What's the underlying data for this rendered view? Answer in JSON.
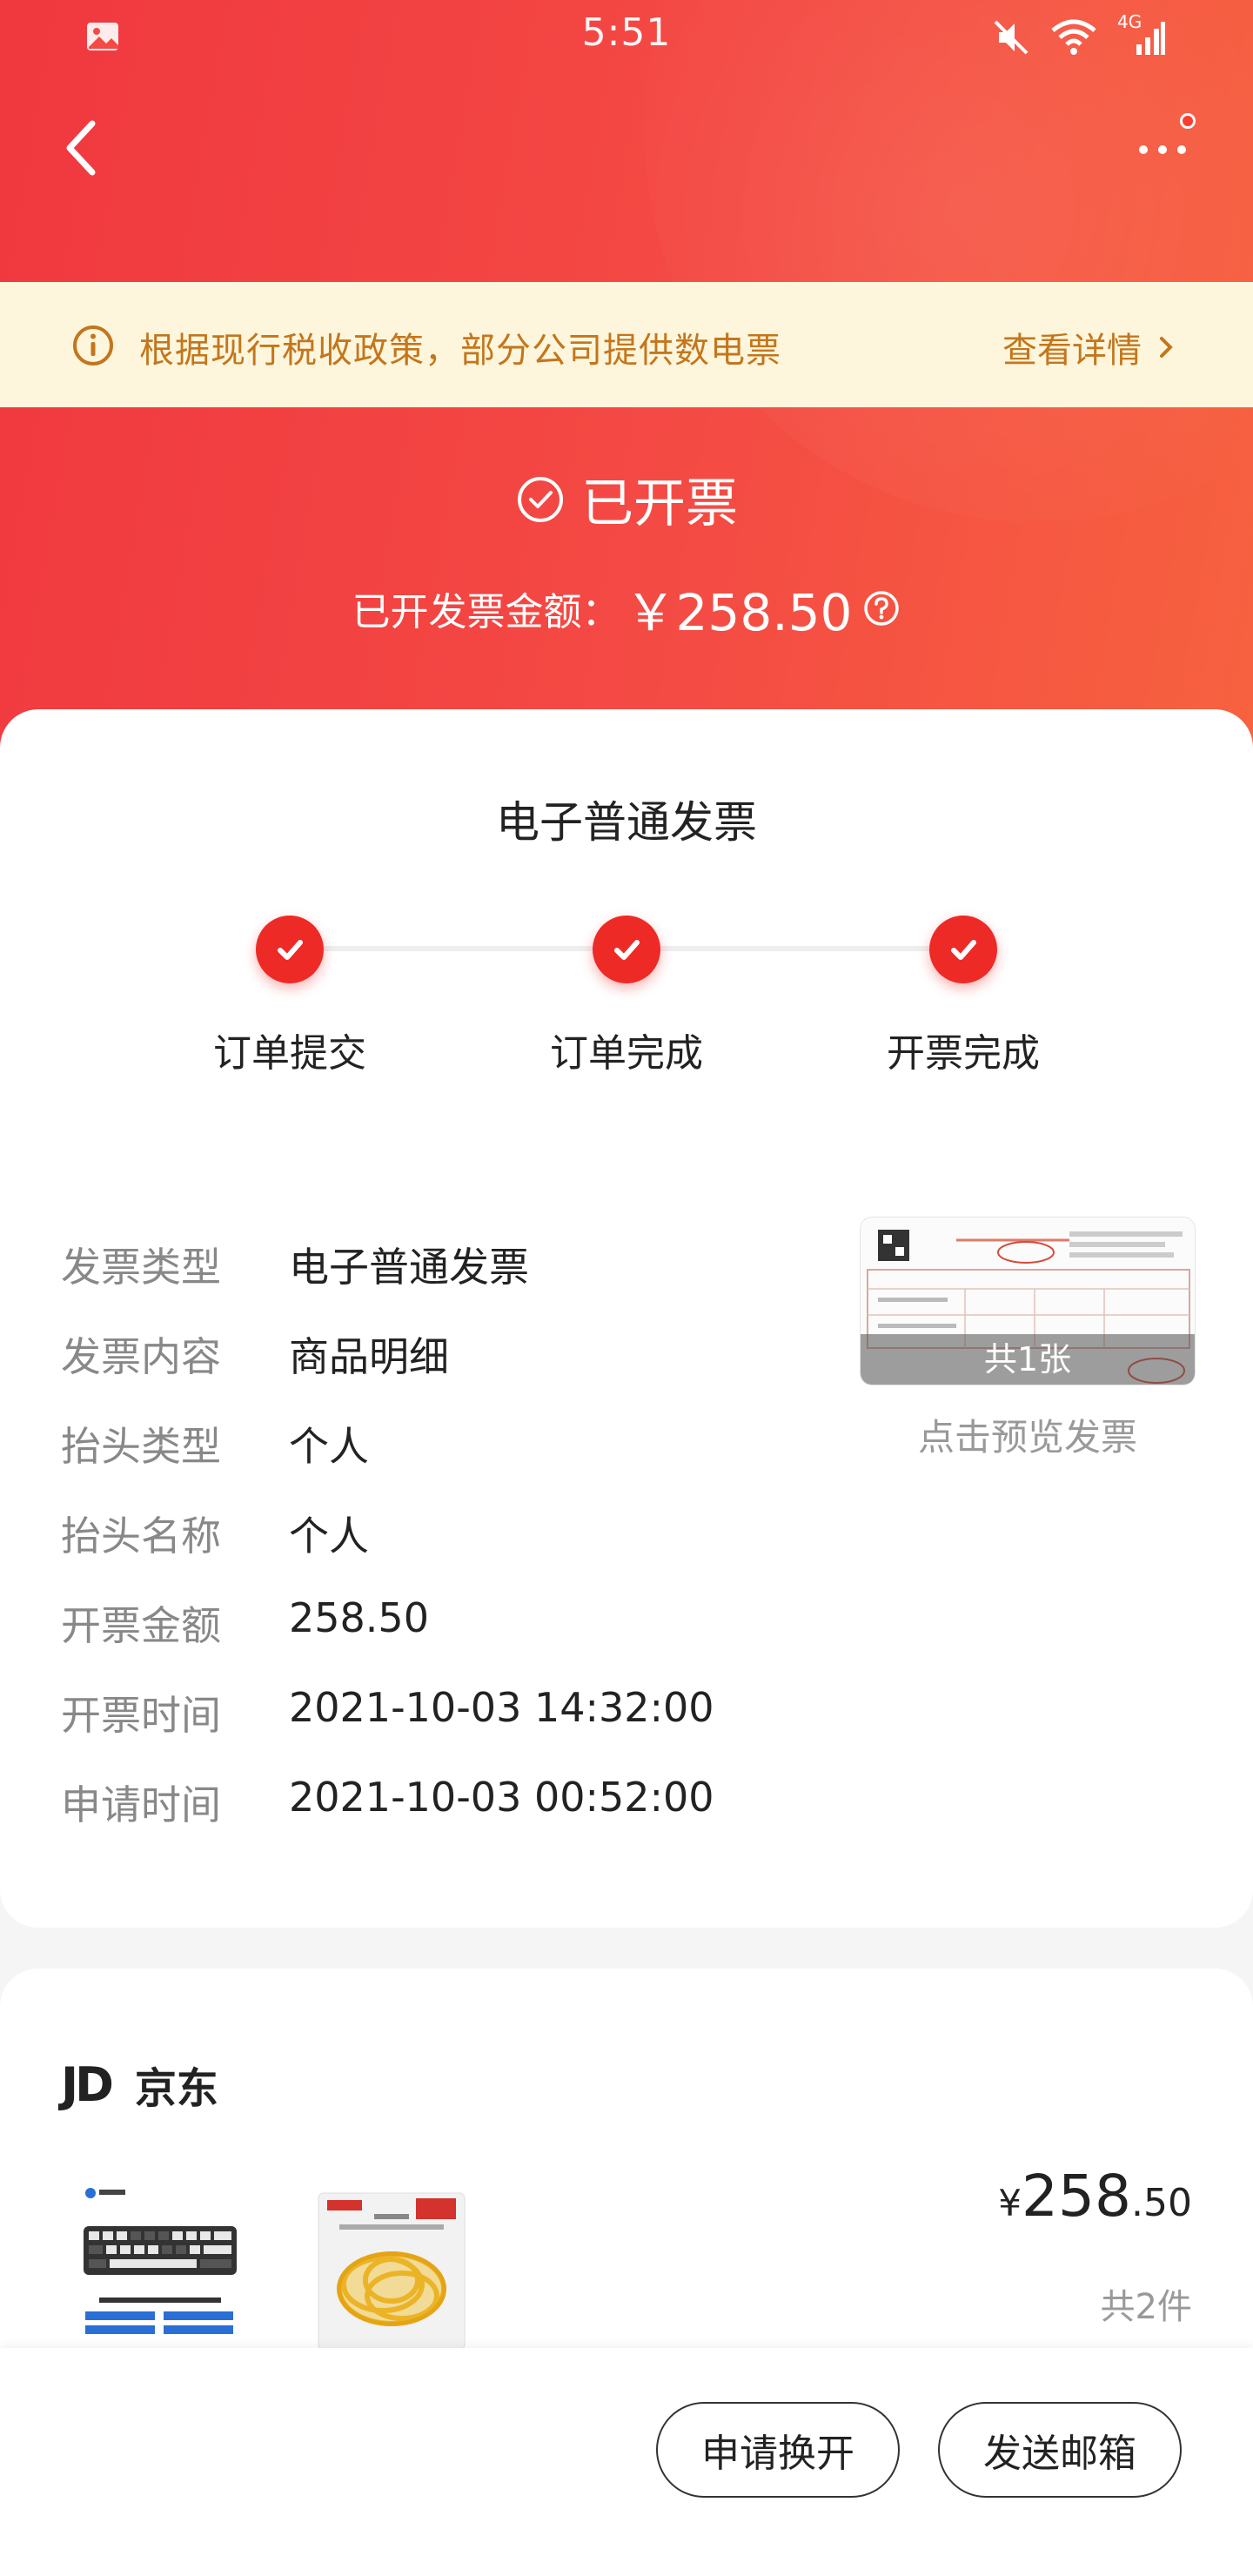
{
  "status_bar": {
    "time": "5:51",
    "network": "4G"
  },
  "notice": {
    "text": "根据现行税收政策，部分公司提供数电票",
    "link": "查看详情"
  },
  "invoice_status": {
    "title": "已开票",
    "amount_label": "已开发票金额：",
    "amount": "￥258.50"
  },
  "card_title": "电子普通发票",
  "steps": [
    {
      "label": "订单提交"
    },
    {
      "label": "订单完成"
    },
    {
      "label": "开票完成"
    }
  ],
  "info": [
    {
      "key": "发票类型",
      "value": "电子普通发票"
    },
    {
      "key": "发票内容",
      "value": "商品明细"
    },
    {
      "key": "抬头类型",
      "value": "个人"
    },
    {
      "key": "抬头名称",
      "value": "个人"
    },
    {
      "key": "开票金额",
      "value": "258.50"
    },
    {
      "key": "开票时间",
      "value": "2021-10-03 14:32:00"
    },
    {
      "key": "申请时间",
      "value": "2021-10-03 00:52:00"
    }
  ],
  "preview": {
    "count": "共1张",
    "caption": "点击预览发票"
  },
  "store": {
    "logo": "JD",
    "name": "京东",
    "price_currency": "¥",
    "price_int": "258",
    "price_dec": ".50",
    "item_count": "共2件"
  },
  "buttons": {
    "reissue": "申请换开",
    "send_email": "发送邮箱"
  },
  "colors": {
    "primary": "#ee2a27",
    "notice_bg": "#fdf6dc",
    "notice_text": "#c4761c"
  }
}
